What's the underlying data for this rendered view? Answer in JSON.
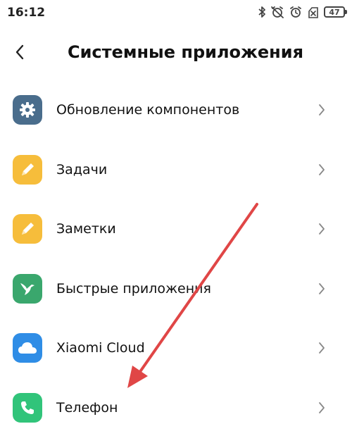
{
  "status_bar": {
    "time": "16:12",
    "battery_level": "47",
    "icons": [
      "bluetooth-icon",
      "alarm-off-icon",
      "alarm-icon",
      "sim-off-icon"
    ]
  },
  "header": {
    "back_icon": "back-chevron-icon",
    "title": "Системные приложения"
  },
  "apps": [
    {
      "label": "Обновление компонентов",
      "icon": "gear-icon",
      "color": "#4a6d8c"
    },
    {
      "label": "Задачи",
      "icon": "pencil-icon",
      "color": "#f6bd3b"
    },
    {
      "label": "Заметки",
      "icon": "pencil-icon",
      "color": "#f6bd3b"
    },
    {
      "label": "Быстрые приложения",
      "icon": "hummingbird-icon",
      "color": "#3aa76d"
    },
    {
      "label": "Xiaomi Cloud",
      "icon": "cloud-icon",
      "color": "#2f8de6"
    },
    {
      "label": "Телефон",
      "icon": "phone-icon",
      "color": "#31c47a"
    }
  ],
  "annotation": {
    "arrow_color": "#e04646"
  }
}
